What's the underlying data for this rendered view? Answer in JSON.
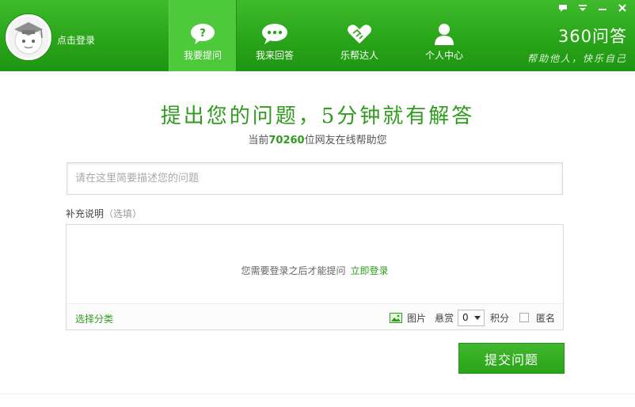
{
  "header": {
    "login_text": "点击登录",
    "nav": [
      {
        "label": "我要提问",
        "icon": "question-bubble-icon",
        "active": true
      },
      {
        "label": "我来回答",
        "icon": "chat-bubble-icon",
        "active": false
      },
      {
        "label": "乐帮达人",
        "icon": "handshake-icon",
        "active": false
      },
      {
        "label": "个人中心",
        "icon": "person-icon",
        "active": false
      }
    ],
    "window_controls": [
      "feedback-icon",
      "menu-icon",
      "minimize-icon",
      "close-icon"
    ],
    "brand_logo": "360问答",
    "brand_slogan": "帮助他人，快乐自己"
  },
  "main": {
    "headline": "提出您的问题，5分钟就有解答",
    "online_prefix": "当前",
    "online_count": "70260",
    "online_suffix": "位网友在线帮助您",
    "question_placeholder": "请在这里简要描述您的问题",
    "supplement_label": "补充说明",
    "supplement_optional": "（选填）",
    "login_notice": "您需要登录之后才能提问",
    "login_link": "立即登录",
    "category_link": "选择分类",
    "image_label": "图片",
    "reward_label": "悬赏",
    "reward_value": "0",
    "points_label": "积分",
    "anonymous_label": "匿名",
    "submit_label": "提交问题"
  },
  "footer": {
    "partial_text": "..."
  },
  "colors": {
    "brand_green": "#2aa51a",
    "accent_green": "#2f9c1e",
    "active_tab": "#4fc93c"
  }
}
